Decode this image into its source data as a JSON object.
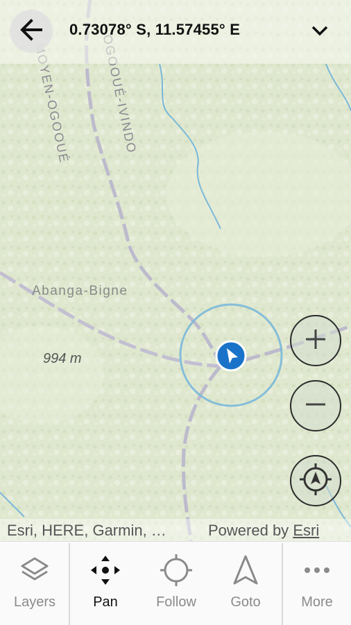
{
  "header": {
    "coordinates": "0.73078° S, 11.57455° E"
  },
  "map": {
    "region_labels": [
      "MOYEN-OGOOUÉ",
      "OGOOUÉ-IVINDO"
    ],
    "place_label": "Abanga-Bigne",
    "elevation_label": "994 m"
  },
  "controls": {
    "zoom_in": "+",
    "zoom_out": "−"
  },
  "attribution": {
    "sources": "Esri, HERE, Garmin, …",
    "powered_by": "Powered by",
    "esri": "Esri"
  },
  "toolbar": {
    "items": [
      {
        "label": "Layers",
        "icon": "layers-icon"
      },
      {
        "label": "Pan",
        "icon": "pan-icon",
        "active": true
      },
      {
        "label": "Follow",
        "icon": "follow-icon"
      },
      {
        "label": "Goto",
        "icon": "goto-icon"
      },
      {
        "label": "More",
        "icon": "more-icon"
      }
    ]
  },
  "colors": {
    "map_base": "#dfe8cf",
    "water": "#7ab8d9",
    "road": "#b9b5cf",
    "location_blue": "#1a73c8"
  }
}
